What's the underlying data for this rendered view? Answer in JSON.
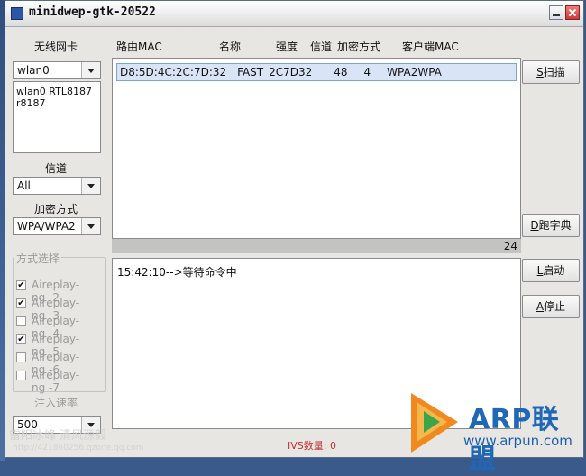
{
  "window": {
    "title": "minidwep-gtk-20522"
  },
  "left": {
    "nic_label": "无线网卡",
    "nic_value": "wlan0",
    "nic_list": [
      "wlan0 RTL8187",
      "r8187"
    ],
    "channel_label": "信道",
    "channel_value": "All",
    "encrypt_label": "加密方式",
    "encrypt_value": "WPA/WPA2",
    "mode_group_title": "方式选择",
    "modes": [
      {
        "label": "Aireplay-ng -2",
        "checked": true
      },
      {
        "label": "Aireplay-ng -3",
        "checked": true
      },
      {
        "label": "Aireplay-ng -4",
        "checked": false
      },
      {
        "label": "Aireplay-ng -5",
        "checked": true
      },
      {
        "label": "Aireplay-ng -6",
        "checked": false
      },
      {
        "label": "Aireplay-ng -7",
        "checked": false
      }
    ],
    "rate_label": "注入速率",
    "rate_value": "500"
  },
  "table": {
    "headers": {
      "mac": "路由MAC",
      "name": "名称",
      "strength": "强度",
      "channel": "信道",
      "encrypt": "加密方式",
      "client": "客户端MAC"
    },
    "selected_row": "D8:5D:4C:2C:7D:32__FAST_2C7D32____48___4___WPA2WPA__"
  },
  "progress": {
    "value": "24"
  },
  "log": {
    "line": "15:42:10-->等待命令中"
  },
  "buttons": {
    "scan_key": "S",
    "scan": "扫描",
    "dict_key": "D",
    "dict": "跑字典",
    "start_key": "L",
    "start": "启动",
    "stop_key": "A",
    "stop": "停止"
  },
  "status": {
    "ivs": "IVS数量: 0"
  },
  "watermark": {
    "left1": "雷阳冰峰 清风源毅",
    "left2": "http://421860256.qzone.qq.com",
    "brand": "ARP联盟",
    "url": "www.arpun.com"
  },
  "colors": {
    "selection": "#d9e5f6",
    "ivs": "#c03030",
    "brand": "#1f67b7"
  }
}
